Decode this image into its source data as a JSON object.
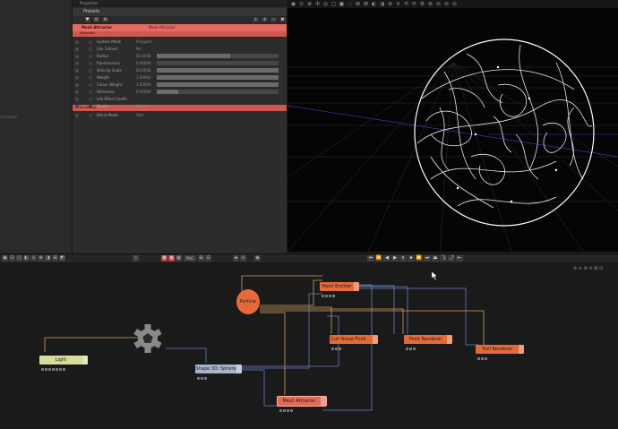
{
  "left_panel": {
    "hint": "ed button"
  },
  "properties": {
    "header": "Properties",
    "presets": "Presets",
    "tools": [
      "♥",
      "⊙",
      "⊖",
      "↓",
      "+",
      "−",
      "✖"
    ],
    "node_title": "Mesh Attractor",
    "node_type": "Mesh Attractor",
    "attributes_label": "Attributes",
    "rows": [
      {
        "name": "System Mode",
        "value": "Polygons",
        "bar": null
      },
      {
        "name": "Use Colours",
        "value": "No",
        "bar": null
      },
      {
        "name": "Radius",
        "value": "60.0000",
        "bar": 0.6
      },
      {
        "name": "Randomness",
        "value": "0.00000",
        "bar": 0.0
      },
      {
        "name": "Velocity Scale",
        "value": "60.0000",
        "bar": 1.0
      },
      {
        "name": "Weight",
        "value": "1.00000",
        "bar": 1.0
      },
      {
        "name": "Colour Weight",
        "value": "1.00000",
        "bar": 1.0
      },
      {
        "name": "Stickiness",
        "value": "0.00000",
        "bar": 0.18
      },
      {
        "name": "Life Effect Coeffs",
        "value": "",
        "bar": null
      },
      {
        "name": "Shader",
        "value": "(None)",
        "bar": null
      }
    ],
    "rendering_label": "Rendering",
    "blend_row": {
      "name": "Blend Mode",
      "value": "Add"
    }
  },
  "viewport": {
    "icons": [
      "◉",
      "⊙",
      "⊕",
      "✣",
      "◎",
      "▢",
      "▣",
      "◌",
      "⊞",
      "⊠",
      "◐",
      "◑",
      "⊛",
      "✕",
      "⟲",
      "⟳",
      "⚙",
      "⊗",
      "⊘",
      "⊜",
      "⊝"
    ]
  },
  "transport": {
    "tools": [
      "▣",
      "⊡",
      "◫",
      "◧",
      "⊙",
      "⊗",
      "◨",
      "⊞",
      "◩"
    ],
    "mid_tools": [
      "◇",
      "■",
      "■",
      "▦",
      "PNG",
      "⊞",
      "⊟",
      "◈",
      "⊙",
      "◉"
    ],
    "buttons": [
      "⏮",
      "⏪",
      "◀",
      "▶",
      "⏸",
      "⏹",
      "⏩",
      "⏭",
      "⏏",
      "⤵",
      "⤴",
      "⇤"
    ]
  },
  "graph": {
    "corner_icons": [
      "⊕",
      "≡",
      "⊗",
      "⊘",
      "⊠",
      "⊟"
    ],
    "nodes": {
      "mesh_emitter": "Mesh Emitter",
      "particle": "Particle",
      "curl_noise": "Curl Noise Fluid ...",
      "point_renderer": "Point Renderer",
      "trail_renderer": "Trail Renderer",
      "light": "Light",
      "shape": "Shape 3D: Sphere",
      "mesh_attractor": "Mesh Attractor"
    }
  }
}
